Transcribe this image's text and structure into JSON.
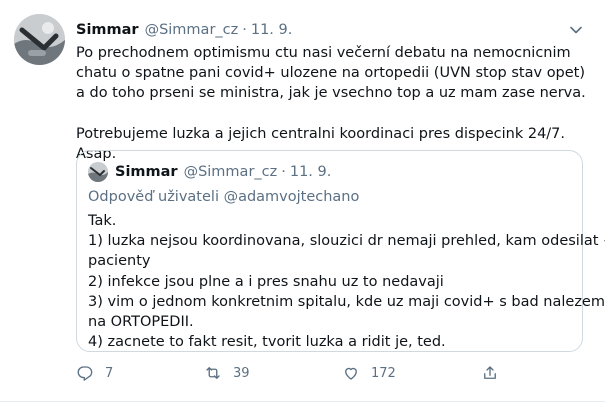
{
  "tweet": {
    "author": {
      "name": "Simmar",
      "handle": "@Simmar_cz",
      "separator": "·",
      "date": "11. 9."
    },
    "text": [
      "Po prechodnem optimismu ctu nasi večerní debatu na nemocnicnim chatu o spatne pani covid+ ulozene na ortopedii (UVN stop stav opet) a do toho prseni se ministra, jak je vsechno top a uz mam zase nerva.",
      "Potrebujeme luzka a jejich centralni koordinaci pres dispecink 24/7. Asap."
    ],
    "quoted": {
      "author": {
        "name": "Simmar",
        "handle": "@Simmar_cz",
        "separator": "·",
        "date": "11. 9."
      },
      "reply_to": "Odpověď uživateli @adamvojtechano",
      "lines": [
        "Tak.",
        "1) luzka nejsou koordinovana, slouzici dr nemaji prehled, kam odesilat +",
        "pacienty",
        "2) infekce jsou plne a i pres snahu uz to nedavaji",
        "3) vim o jednom konkretnim spitalu, kde uz maji covid+ s bad nalezem",
        "na ORTOPEDII.",
        "4) zacnete to fakt resit, tvorit luzka a ridit je, ted."
      ]
    },
    "actions": {
      "reply": {
        "icon": "reply-icon",
        "count": "7"
      },
      "retweet": {
        "icon": "retweet-icon",
        "count": "39"
      },
      "like": {
        "icon": "heart-icon",
        "count": "172"
      },
      "share": {
        "icon": "share-icon"
      }
    },
    "menu_icon": "chevron-down-icon"
  },
  "colors": {
    "text": "#0f1419",
    "secondary": "#5b7083",
    "border": "#cfd9de"
  }
}
